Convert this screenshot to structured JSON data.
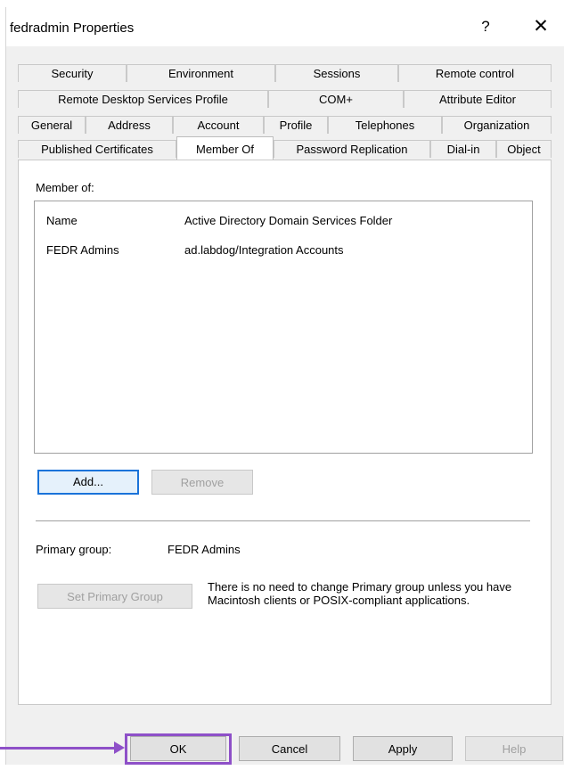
{
  "window": {
    "title": "fedradmin Properties",
    "help_label": "?",
    "close_label": "✕"
  },
  "tabs": {
    "row1": [
      "Security",
      "Environment",
      "Sessions",
      "Remote control"
    ],
    "row2": [
      "Remote Desktop Services Profile",
      "COM+",
      "Attribute Editor"
    ],
    "row3": [
      "General",
      "Address",
      "Account",
      "Profile",
      "Telephones",
      "Organization"
    ],
    "row4": [
      "Published Certificates",
      "Member Of",
      "Password Replication",
      "Dial-in",
      "Object"
    ],
    "selected": "Member Of"
  },
  "member_of": {
    "section_label": "Member of:",
    "columns": [
      "Name",
      "Active Directory Domain Services Folder"
    ],
    "rows": [
      [
        "FEDR Admins",
        "ad.labdog/Integration Accounts"
      ]
    ],
    "add_label": "Add...",
    "remove_label": "Remove"
  },
  "primary_group": {
    "label": "Primary group:",
    "value": "FEDR Admins",
    "set_button_label": "Set Primary Group",
    "note": "There is no need to change Primary group unless you have Macintosh clients or POSIX-compliant applications."
  },
  "footer": {
    "ok_label": "OK",
    "cancel_label": "Cancel",
    "apply_label": "Apply",
    "help_label": "Help"
  },
  "annotation": {
    "color": "#8e50c8"
  }
}
